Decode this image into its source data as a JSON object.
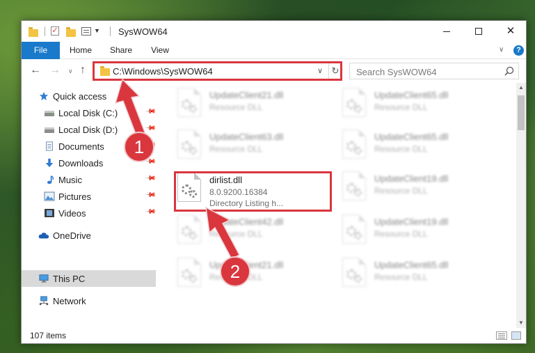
{
  "window": {
    "title": "SysWOW64",
    "controls": {
      "minimize": "—",
      "maximize": "",
      "close": "✕"
    }
  },
  "ribbon": {
    "tabs": [
      {
        "label": "File",
        "active": true
      },
      {
        "label": "Home"
      },
      {
        "label": "Share"
      },
      {
        "label": "View"
      }
    ],
    "help": "?"
  },
  "address": {
    "path": "C:\\Windows\\SysWOW64",
    "search_placeholder": "Search SysWOW64"
  },
  "nav": {
    "items": [
      {
        "label": "Quick access",
        "icon": "star-icon"
      },
      {
        "label": "Local Disk (C:)",
        "icon": "drive-icon",
        "pinned": true
      },
      {
        "label": "Local Disk (D:)",
        "icon": "drive-icon",
        "pinned": true
      },
      {
        "label": "Documents",
        "icon": "document-icon",
        "pinned": true
      },
      {
        "label": "Downloads",
        "icon": "download-icon",
        "pinned": true
      },
      {
        "label": "Music",
        "icon": "music-icon",
        "pinned": true
      },
      {
        "label": "Pictures",
        "icon": "picture-icon",
        "pinned": true
      },
      {
        "label": "Videos",
        "icon": "video-icon",
        "pinned": true
      },
      {
        "label": "OneDrive",
        "icon": "cloud-icon"
      },
      {
        "label": "This PC",
        "icon": "computer-icon",
        "selected": true
      },
      {
        "label": "Network",
        "icon": "network-icon"
      }
    ]
  },
  "files": [
    {
      "name": "UpdateClient21.dll",
      "type": "Resource DLL"
    },
    {
      "name": "UpdateClient65.dll",
      "type": "Resource DLL"
    },
    {
      "name": "UpdateClient63.dll",
      "type": "Resource DLL"
    },
    {
      "name": "UpdateClient65.dll",
      "type": "Resource DLL"
    },
    {
      "name": "dirlist.dll",
      "version": "8.0.9200.16384",
      "type": "Directory Listing h..."
    },
    {
      "name": "UpdateClient19.dll",
      "type": "Resource DLL"
    },
    {
      "name": "UpdateClient42.dll",
      "type": "Resource DLL"
    },
    {
      "name": "UpdateClient19.dll",
      "type": "Resource DLL"
    },
    {
      "name": "UpdateClient21.dll",
      "type": "Resource DLL"
    },
    {
      "name": "UpdateClient65.dll",
      "type": "Resource DLL"
    }
  ],
  "status": {
    "count": "107 items"
  },
  "annotations": {
    "badge1": "1",
    "badge2": "2",
    "highlight_color": "#d9363e"
  }
}
